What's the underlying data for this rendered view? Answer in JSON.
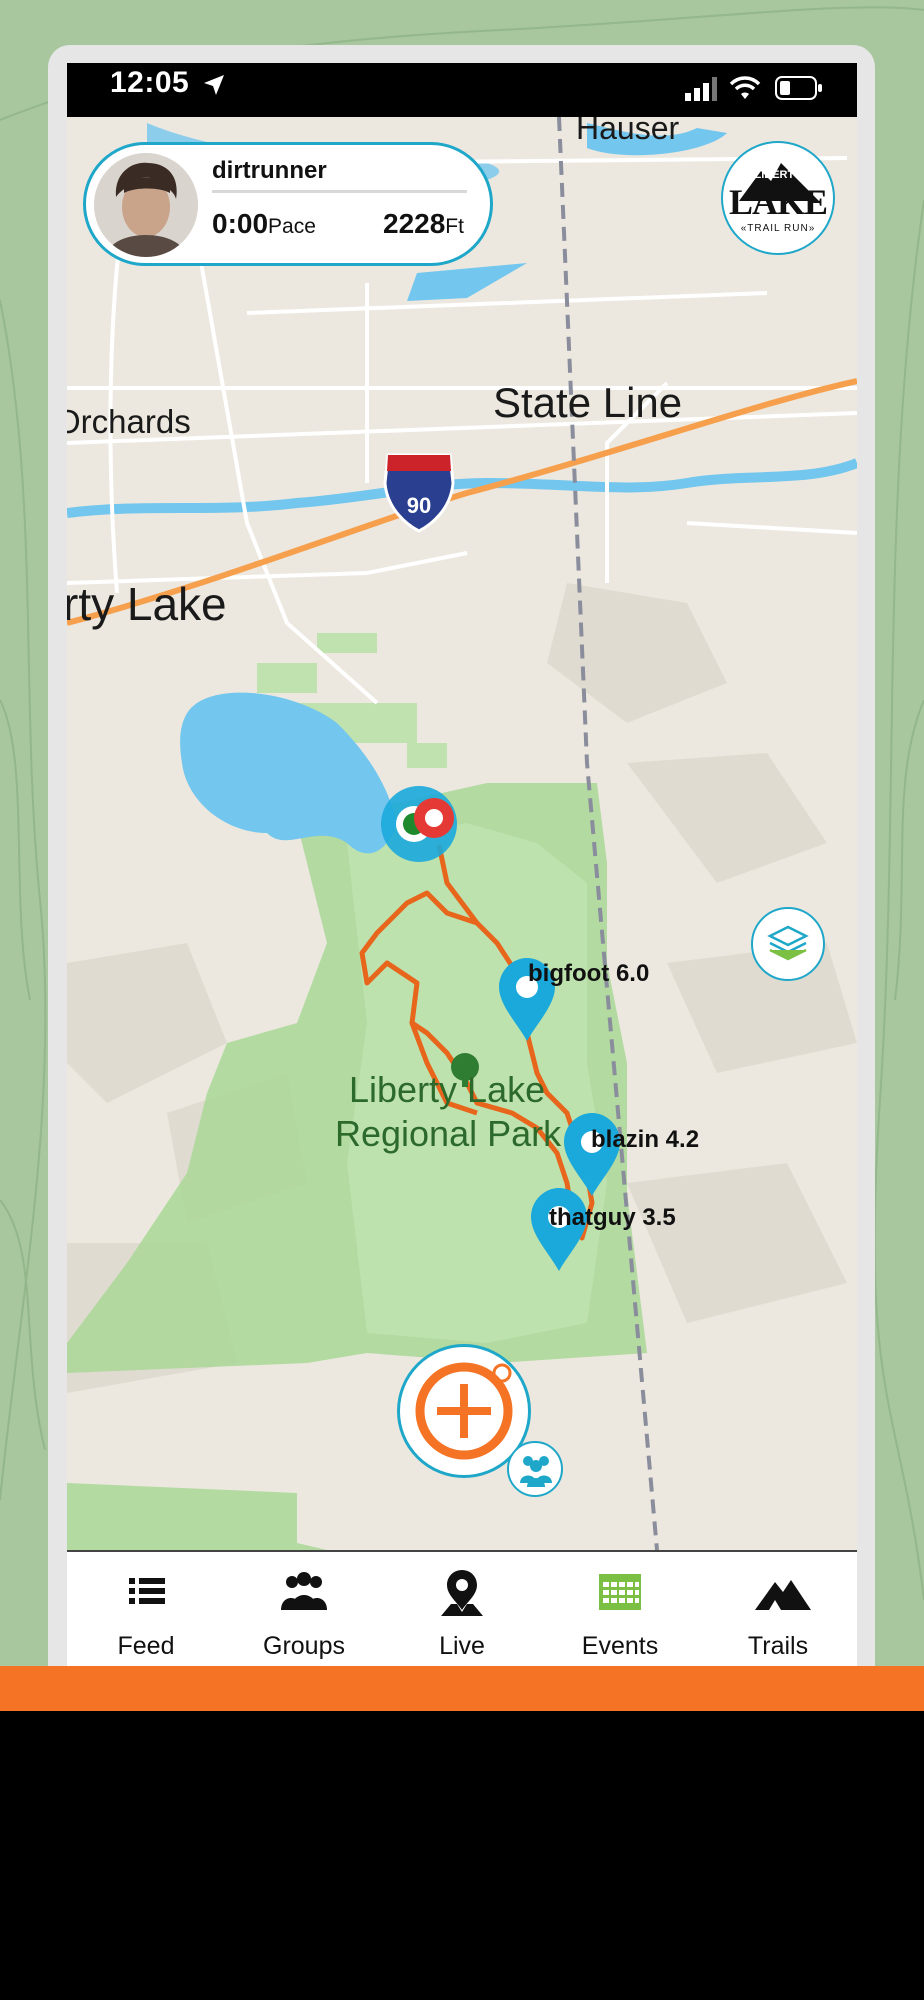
{
  "status_bar": {
    "time": "12:05"
  },
  "user": {
    "name": "dirtrunner",
    "pace_value": "0:00",
    "pace_unit": "Pace",
    "elevation_value": "2228",
    "elevation_unit": "Ft"
  },
  "logo": {
    "top": "LIBERTY",
    "main": "LAKE",
    "bottom": "«TRAIL RUN»"
  },
  "map": {
    "labels": {
      "hauser": "Hauser",
      "state_line": "State Line",
      "orchards": "Orchards",
      "liberty_lake": "rty Lake",
      "park_line1": "Liberty Lake",
      "park_line2": "Regional Park",
      "interstate": "90"
    },
    "runners": [
      {
        "name": "bigfoot",
        "distance": "6.0",
        "label": "bigfoot 6.0"
      },
      {
        "name": "blazin",
        "distance": "4.2",
        "label": "blazin 4.2"
      },
      {
        "name": "thatguy",
        "distance": "3.5",
        "label": "thatguy 3.5"
      }
    ],
    "colors": {
      "water": "#73c6ee",
      "park": "#a9d796",
      "route": "#e8651c",
      "pin": "#1ba9dc",
      "highway": "#f6a04d"
    }
  },
  "tabs": [
    {
      "label": "Feed",
      "icon": "list-icon"
    },
    {
      "label": "Groups",
      "icon": "groups-icon"
    },
    {
      "label": "Live",
      "icon": "map-pin-icon"
    },
    {
      "label": "Events",
      "icon": "calendar-icon"
    },
    {
      "label": "Trails",
      "icon": "mountain-icon"
    }
  ],
  "accent_colors": {
    "brand_orange": "#f47324",
    "teal": "#1fa7c9",
    "events_green": "#7bc043"
  }
}
